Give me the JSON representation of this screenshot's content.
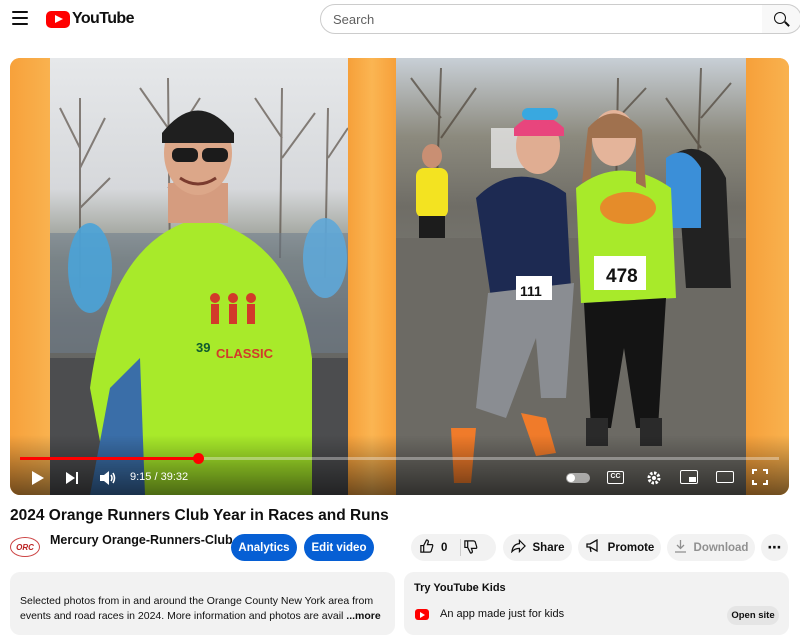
{
  "header": {
    "logo_text": "YouTube",
    "search_placeholder": "Search"
  },
  "player": {
    "time_display": "9:15 / 39:32",
    "progress_fraction": 0.234,
    "photo_left": {
      "shirt_text_number": "39",
      "shirt_text_word": "CLASSIC"
    },
    "photo_right": {
      "bib_left": "111",
      "bib_right": "478"
    },
    "cc_label": "CC"
  },
  "video": {
    "title": "2024 Orange Runners Club Year in Races and Runs",
    "channel_avatar_text": "ORC",
    "channel_name": "Mercury Orange-Runners-Club",
    "analytics_label": "Analytics",
    "edit_label": "Edit video",
    "like_count": "0",
    "share_label": "Share",
    "promote_label": "Promote",
    "download_label": "Download",
    "more_label": "⋯"
  },
  "description": {
    "text": "Selected photos from in and around the Orange County New York area from events and road races in 2024.  More information and photos are avail",
    "more": "...more"
  },
  "kids": {
    "title": "Try YouTube Kids",
    "text": "An app made just for kids",
    "button": "Open site"
  },
  "icons": {
    "menu": "menu-icon",
    "search": "search-icon",
    "play": "play-icon",
    "next": "next-icon",
    "volume": "volume-icon",
    "settings": "gear-icon",
    "like": "thumbs-up-icon",
    "dislike": "thumbs-down-icon",
    "share": "share-arrow-icon",
    "promote": "megaphone-icon",
    "download": "download-icon"
  },
  "colors": {
    "brand_red": "#ff0000",
    "button_blue": "#065fd4",
    "frame_orange": "#f9a43a",
    "shirt_green": "#a8ea2a"
  }
}
